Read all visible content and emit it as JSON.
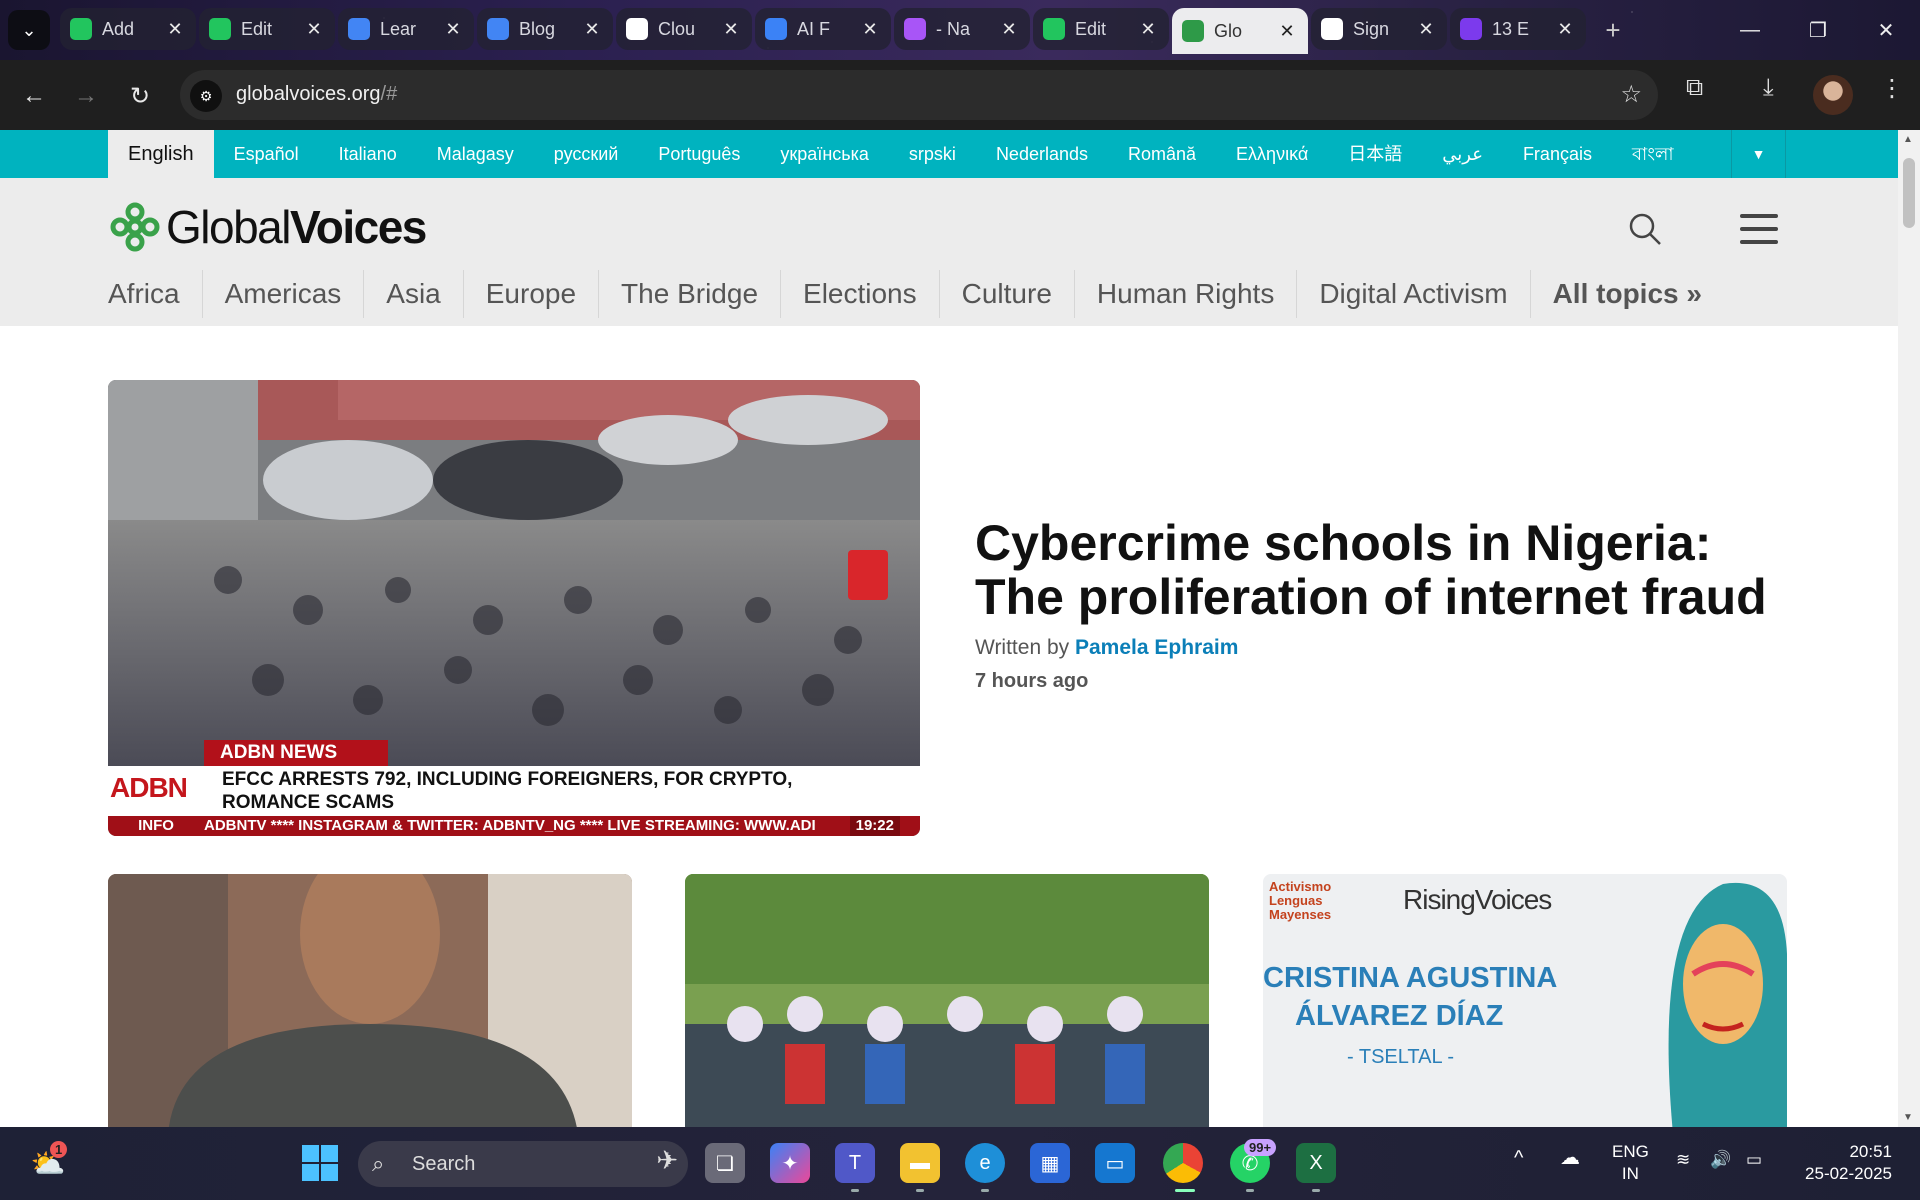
{
  "browser": {
    "tabs": [
      {
        "title": "Add",
        "favicon": "dots-icon",
        "color": "#22c55e"
      },
      {
        "title": "Edit",
        "favicon": "dots-icon",
        "color": "#22c55e"
      },
      {
        "title": "Lear",
        "favicon": "doc-icon",
        "color": "#4285f4"
      },
      {
        "title": "Blog",
        "favicon": "doc-icon",
        "color": "#4285f4"
      },
      {
        "title": "Clou",
        "favicon": "openai-icon",
        "color": "#ffffff"
      },
      {
        "title": "AI F",
        "favicon": "swirl-icon",
        "color": "#3b82f6"
      },
      {
        "title": "- Na",
        "favicon": "slash-icon",
        "color": "#a855f7"
      },
      {
        "title": "Edit",
        "favicon": "dots-icon",
        "color": "#22c55e"
      },
      {
        "title": "Glo",
        "favicon": "globalvoices-icon",
        "color": "#2e9a48",
        "active": true
      },
      {
        "title": "Sign",
        "favicon": "chat-icon",
        "color": "#ffffff"
      },
      {
        "title": "13 E",
        "favicon": "heart-icon",
        "color": "#7c3aed"
      }
    ],
    "url_host": "globalvoices.org",
    "url_path": "/#"
  },
  "languages": [
    "English",
    "Español",
    "Italiano",
    "Malagasy",
    "русский",
    "Português",
    "українська",
    "srpski",
    "Nederlands",
    "Română",
    "Ελληνικά",
    "日本語",
    "عربي",
    "Français",
    "বাংলা"
  ],
  "active_language": "English",
  "logo": {
    "part1": "Global",
    "part2": "Voices"
  },
  "topics": [
    "Africa",
    "Americas",
    "Asia",
    "Europe",
    "The Bridge",
    "Elections",
    "Culture",
    "Human Rights",
    "Digital Activism",
    "All topics »"
  ],
  "featured": {
    "headline": "Cybercrime schools in Nigeria: The proliferation of internet fraud",
    "byline_prefix": "Written by",
    "author": "Pamela Ephraim",
    "time": "7 hours ago",
    "image_caption": {
      "channel": "ADBN NEWS",
      "logo": "ADBN",
      "headline_line1": "EFCC ARRESTS 792, INCLUDING FOREIGNERS, FOR CRYPTO,",
      "headline_line2": "ROMANCE SCAMS",
      "info": "INFO",
      "ticker": "ADBNTV **** INSTAGRAM & TWITTER: ADBNTV_NG **** LIVE STREAMING: WWW.ADI",
      "clock": "19:22"
    }
  },
  "card3": {
    "tag": "Activismo Lenguas Mayenses",
    "brand": "RisingVoices",
    "name_line1": "CRISTINA AGUSTINA",
    "name_line2": "ÁLVAREZ DÍAZ",
    "language": "- TSELTAL -"
  },
  "taskbar": {
    "search_label": "Search",
    "lang_line1": "ENG",
    "lang_line2": "IN",
    "time": "20:51",
    "date": "25-02-2025",
    "whatsapp_badge": "99+",
    "weather_badge": "1"
  }
}
